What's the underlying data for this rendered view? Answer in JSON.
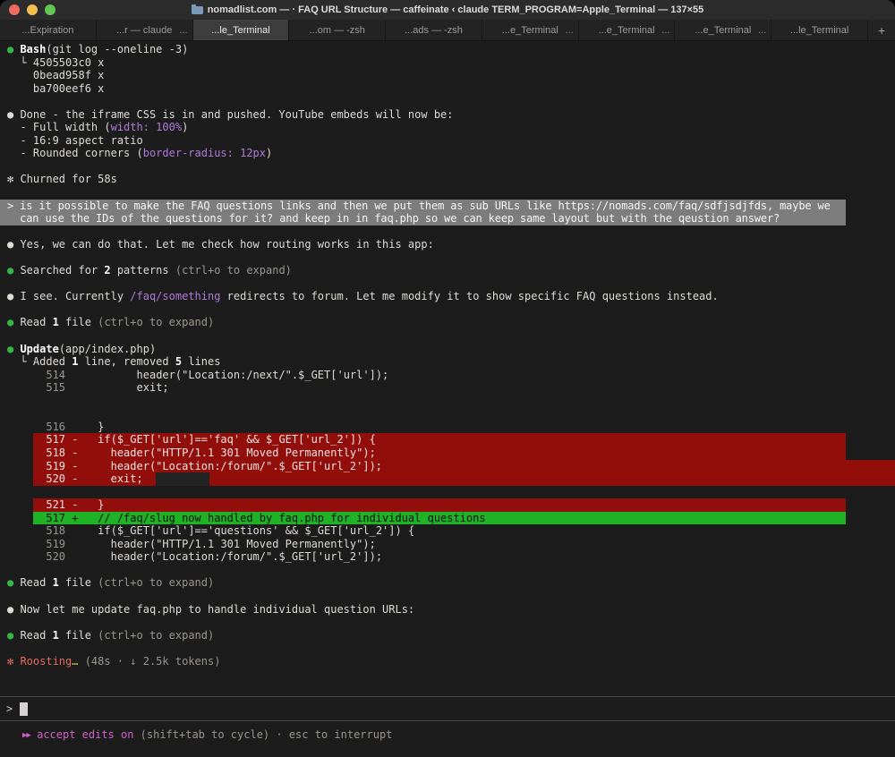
{
  "window": {
    "title": "nomadlist.com — · FAQ URL Structure — caffeinate ‹ claude TERM_PROGRAM=Apple_Terminal — 137×55"
  },
  "tabs": {
    "new_tab_label": "+",
    "items": [
      {
        "label": "...Expiration",
        "active": false,
        "more": false
      },
      {
        "label": "...r — claude",
        "active": false,
        "more": true
      },
      {
        "label": "...le_Terminal",
        "active": true,
        "more": false
      },
      {
        "label": "...om — -zsh",
        "active": false,
        "more": false
      },
      {
        "label": "...ads — -zsh",
        "active": false,
        "more": false
      },
      {
        "label": "...e_Terminal",
        "active": false,
        "more": true
      },
      {
        "label": "...e_Terminal",
        "active": false,
        "more": true
      },
      {
        "label": "...e_Terminal",
        "active": false,
        "more": true
      },
      {
        "label": "...le_Terminal",
        "active": false,
        "more": false
      }
    ]
  },
  "colors": {
    "diff_removed_bg": "#920e0a",
    "diff_added_bg": "#1fb227",
    "bullet_green": "#33b747",
    "code_purple": "#b07ad8",
    "status_magenta": "#d160cb",
    "spinner_salmon": "#e56a5d",
    "user_block_gray": "#7c7c7c"
  },
  "terminal": {
    "lines": [
      {
        "parts": [
          {
            "t": "● ",
            "s": "g"
          },
          {
            "t": "Bash",
            "s": "b"
          },
          {
            "t": "(git log --oneline -3)"
          }
        ]
      },
      {
        "parts": [
          {
            "t": "  └ 4505503c0 x"
          }
        ]
      },
      {
        "parts": [
          {
            "t": "    0bead958f x"
          }
        ]
      },
      {
        "parts": [
          {
            "t": "    ba700eef6 x"
          }
        ]
      },
      {},
      {
        "parts": [
          {
            "t": "● Done - the iframe CSS is in and pushed. YouTube embeds will now be:"
          }
        ]
      },
      {
        "parts": [
          {
            "t": "  - Full width ("
          },
          {
            "t": "width: 100%",
            "s": "p"
          },
          {
            "t": ")"
          }
        ]
      },
      {
        "parts": [
          {
            "t": "  - 16:9 aspect ratio"
          }
        ]
      },
      {
        "parts": [
          {
            "t": "  - Rounded corners ("
          },
          {
            "t": "border-radius: 12px",
            "s": "p"
          },
          {
            "t": ")"
          }
        ]
      },
      {},
      {
        "parts": [
          {
            "t": "✻ Churned for 58s"
          }
        ]
      },
      {},
      {
        "hl": "user",
        "parts": [
          {
            "t": "> is it possible to make the FAQ questions links and then we put them as sub URLs like https://nomads.com/faq/sdfjsdjfds, maybe we"
          }
        ]
      },
      {
        "hl": "user",
        "parts": [
          {
            "t": "  can use the IDs of the questions for it? and keep in in faq.php so we can keep same layout but with the qeustion answer?"
          }
        ]
      },
      {},
      {
        "parts": [
          {
            "t": "● Yes, we can do that. Let me check how routing works in this app:"
          }
        ]
      },
      {},
      {
        "parts": [
          {
            "t": "● ",
            "s": "g"
          },
          {
            "t": "Searched for "
          },
          {
            "t": "2",
            "s": "b"
          },
          {
            "t": " patterns "
          },
          {
            "t": "(ctrl+o to expand)",
            "s": "d"
          }
        ]
      },
      {},
      {
        "parts": [
          {
            "t": "● I see. Currently "
          },
          {
            "t": "/faq/something",
            "s": "p"
          },
          {
            "t": " redirects to forum. Let me modify it to show specific FAQ questions instead."
          }
        ]
      },
      {},
      {
        "parts": [
          {
            "t": "● ",
            "s": "g"
          },
          {
            "t": "Read "
          },
          {
            "t": "1",
            "s": "b"
          },
          {
            "t": " file "
          },
          {
            "t": "(ctrl+o to expand)",
            "s": "d"
          }
        ]
      },
      {},
      {
        "parts": [
          {
            "t": "● ",
            "s": "g"
          },
          {
            "t": "Update",
            "s": "b"
          },
          {
            "t": "(app/index.php)"
          }
        ]
      },
      {
        "parts": [
          {
            "t": "  └ Added "
          },
          {
            "t": "1",
            "s": "b"
          },
          {
            "t": " line, removed "
          },
          {
            "t": "5",
            "s": "b"
          },
          {
            "t": " lines"
          }
        ]
      },
      {
        "parts": [
          {
            "t": "      "
          },
          {
            "t": "514",
            "s": "d"
          },
          {
            "t": "           header(\"Location:/next/\".$_GET['url']);"
          }
        ]
      },
      {
        "parts": [
          {
            "t": "      "
          },
          {
            "t": "515",
            "s": "d"
          },
          {
            "t": "           exit;"
          }
        ]
      },
      {},
      {},
      {
        "parts": [
          {
            "t": "      "
          },
          {
            "t": "516",
            "s": "d"
          },
          {
            "t": "     }"
          }
        ]
      },
      {
        "hl": "red",
        "lead": "    ",
        "parts": [
          {
            "t": "  517 -   if($_GET['url']=='faq' && $_GET['url_2']) {"
          }
        ]
      },
      {
        "hl": "red",
        "lead": "    ",
        "parts": [
          {
            "t": "  518 -     header(\"HTTP/1.1 301 Moved Permanently\");"
          }
        ]
      },
      {
        "hl": "r519",
        "lead": "    ",
        "parts": [
          {
            "t": "  519 -     header(\"Location:/forum/\".$_GET['url_2']);"
          }
        ]
      },
      {
        "hl": "r520",
        "lead": "    ",
        "parts": [
          {
            "t": "  520 -     exit;  "
          }
        ]
      },
      {},
      {
        "hl": "red",
        "lead": "    ",
        "parts": [
          {
            "t": "  521 -   }"
          }
        ]
      },
      {
        "hl": "green",
        "lead": "    ",
        "parts": [
          {
            "t": "  517 +   // /faq/slug now handled by faq.php for individual questions"
          }
        ]
      },
      {
        "parts": [
          {
            "t": "      "
          },
          {
            "t": "518",
            "s": "d"
          },
          {
            "t": "     if($_GET['url']=='questions' && $_GET['url_2']) {"
          }
        ]
      },
      {
        "parts": [
          {
            "t": "      "
          },
          {
            "t": "519",
            "s": "d"
          },
          {
            "t": "       header(\"HTTP/1.1 301 Moved Permanently\");"
          }
        ]
      },
      {
        "parts": [
          {
            "t": "      "
          },
          {
            "t": "520",
            "s": "d"
          },
          {
            "t": "       header(\"Location:/forum/\".$_GET['url_2']);"
          }
        ]
      },
      {},
      {
        "parts": [
          {
            "t": "● ",
            "s": "g"
          },
          {
            "t": "Read "
          },
          {
            "t": "1",
            "s": "b"
          },
          {
            "t": " file "
          },
          {
            "t": "(ctrl+o to expand)",
            "s": "d"
          }
        ]
      },
      {},
      {
        "parts": [
          {
            "t": "● Now let me update faq.php to handle individual question URLs:"
          }
        ]
      },
      {},
      {
        "parts": [
          {
            "t": "● ",
            "s": "g"
          },
          {
            "t": "Read "
          },
          {
            "t": "1",
            "s": "b"
          },
          {
            "t": " file "
          },
          {
            "t": "(ctrl+o to expand)",
            "s": "d"
          }
        ]
      },
      {},
      {
        "parts": [
          {
            "t": "✻ Roosting",
            "s": "salmon"
          },
          {
            "t": "…",
            "s": "yellow"
          },
          {
            "t": " (48s · ↓ 2.5k tokens)",
            "s": "d"
          }
        ]
      }
    ]
  },
  "input": {
    "prompt": ">"
  },
  "status": {
    "arrows": "▶▶",
    "mode": " accept edits on",
    "hint": " (shift+tab to cycle) · esc to interrupt"
  }
}
